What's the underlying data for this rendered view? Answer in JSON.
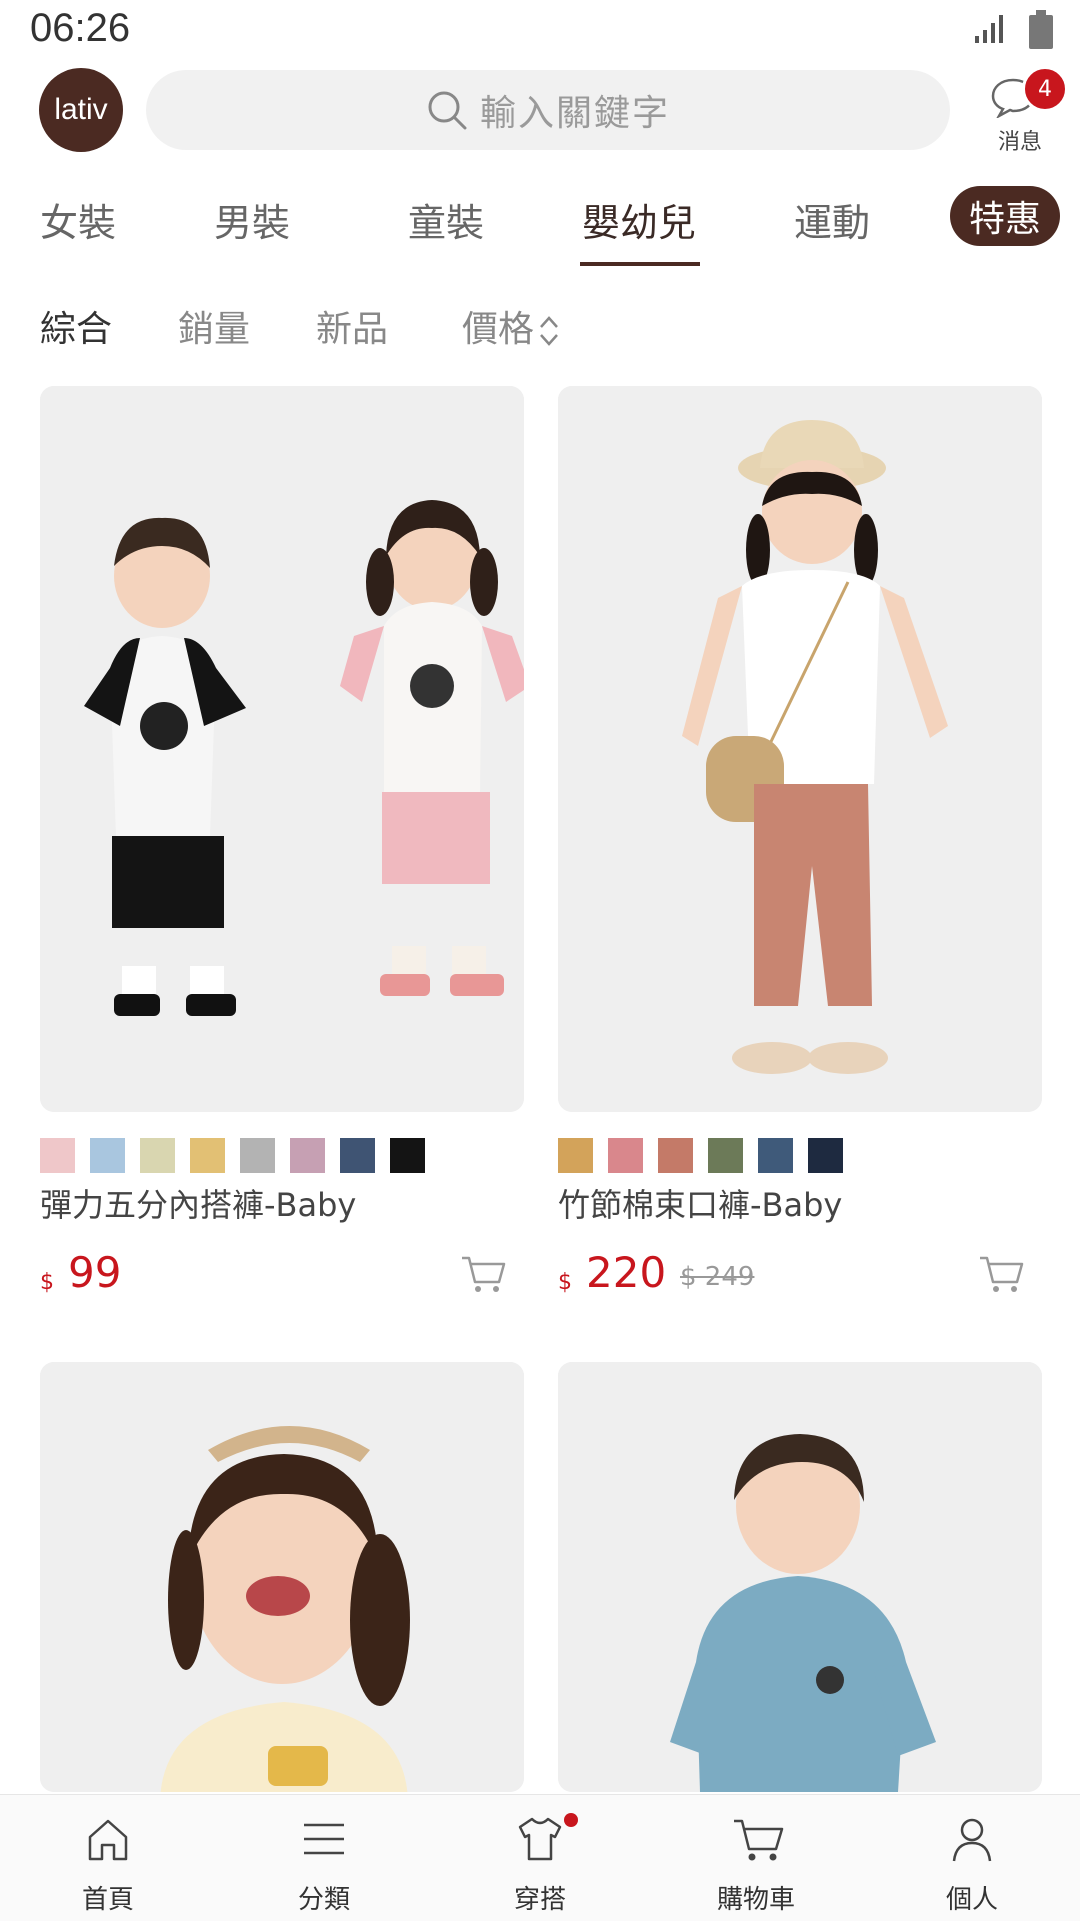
{
  "status": {
    "time": "06:26"
  },
  "header": {
    "logo_text": "lativ",
    "search_placeholder": "輸入關鍵字",
    "messages": {
      "label": "消息",
      "badge": "4"
    }
  },
  "category_tabs": [
    {
      "label": "女裝"
    },
    {
      "label": "男裝"
    },
    {
      "label": "童裝"
    },
    {
      "label": "嬰幼兒",
      "active": true
    },
    {
      "label": "運動"
    }
  ],
  "special_tab": {
    "label": "特惠"
  },
  "sort": {
    "items": [
      "綜合",
      "銷量",
      "新品",
      "價格"
    ],
    "active": "綜合"
  },
  "products": [
    {
      "name": "彈力五分內搭褲-Baby",
      "currency": "$",
      "price": "99",
      "original_price": "",
      "swatches": [
        "#efc7c9",
        "#a9c6df",
        "#d9d6b0",
        "#e2c074",
        "#b3b3b3",
        "#c6a0b3",
        "#3f5473",
        "#141414"
      ]
    },
    {
      "name": "竹節棉束口褲-Baby",
      "currency": "$",
      "price": "220",
      "original_price": "$ 249",
      "swatches": [
        "#d3a35a",
        "#d9878c",
        "#c47a68",
        "#6c7a58",
        "#3f5a7a",
        "#1e2a40"
      ]
    },
    {
      "name": "",
      "price": "",
      "swatches": []
    },
    {
      "name": "",
      "price": "",
      "swatches": []
    }
  ],
  "bottom_nav": [
    {
      "label": "首頁",
      "icon": "home-icon"
    },
    {
      "label": "分類",
      "icon": "menu-icon"
    },
    {
      "label": "穿搭",
      "icon": "shirt-icon",
      "dot": true
    },
    {
      "label": "購物車",
      "icon": "cart-icon"
    },
    {
      "label": "個人",
      "icon": "person-icon"
    }
  ],
  "colors": {
    "brand": "#4b2a22",
    "price": "#c8161d"
  }
}
